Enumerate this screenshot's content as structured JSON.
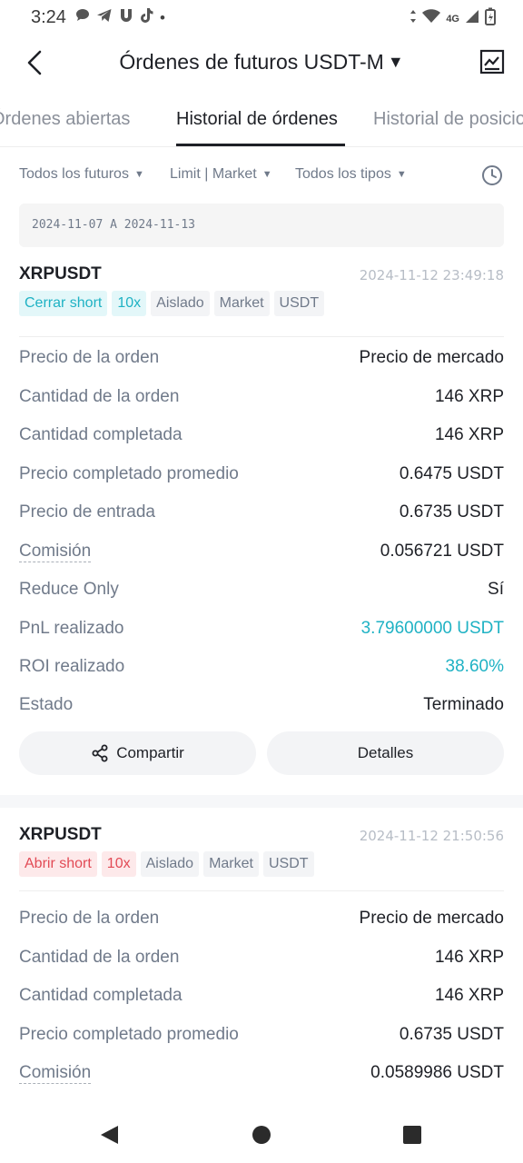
{
  "status_bar": {
    "time": "3:24",
    "notification_icons": [
      "message-icon",
      "telegram-icon",
      "threads-icon",
      "tiktok-icon"
    ],
    "dot": "•",
    "network": "4G",
    "icons": [
      "data-arrows-icon",
      "wifi-icon",
      "signal-icon",
      "battery-icon"
    ]
  },
  "header": {
    "title": "Órdenes de futuros USDT-M",
    "title_caret": "▼"
  },
  "tabs": [
    {
      "label": "Órdenes abiertas",
      "active": false
    },
    {
      "label": "Historial de órdenes",
      "active": true
    },
    {
      "label": "Historial de posiciones",
      "active": false
    }
  ],
  "filters": {
    "futures": "Todos los futuros",
    "order_type": "Limit | Market",
    "all_types": "Todos los tipos",
    "caret": "▼"
  },
  "date_range": "2024-11-07  A  2024-11-13",
  "orders": [
    {
      "symbol": "XRPUSDT",
      "timestamp": "2024-11-12 23:49:18",
      "tags": [
        {
          "label": "Cerrar short",
          "style": "teal"
        },
        {
          "label": "10x",
          "style": "teal"
        },
        {
          "label": "Aislado",
          "style": "gray"
        },
        {
          "label": "Market",
          "style": "gray"
        },
        {
          "label": "USDT",
          "style": "gray"
        }
      ],
      "rows": [
        {
          "label": "Precio de la orden",
          "value": "Precio de mercado"
        },
        {
          "label": "Cantidad de la orden",
          "value": "146 XRP"
        },
        {
          "label": "Cantidad completada",
          "value": "146 XRP"
        },
        {
          "label": "Precio completado promedio",
          "value": "0.6475 USDT"
        },
        {
          "label": "Precio de entrada",
          "value": "0.6735 USDT"
        },
        {
          "label": "Comisión",
          "value": "0.056721 USDT"
        },
        {
          "label": "Reduce Only",
          "value": "Sí"
        },
        {
          "label": "PnL realizado",
          "value": "3.79600000 USDT"
        },
        {
          "label": "ROI realizado",
          "value": "38.60%"
        },
        {
          "label": "Estado",
          "value": "Terminado"
        }
      ],
      "share_label": "Compartir",
      "details_label": "Detalles"
    },
    {
      "symbol": "XRPUSDT",
      "timestamp": "2024-11-12 21:50:56",
      "tags": [
        {
          "label": "Abrir short",
          "style": "red"
        },
        {
          "label": "10x",
          "style": "red"
        },
        {
          "label": "Aislado",
          "style": "gray"
        },
        {
          "label": "Market",
          "style": "gray"
        },
        {
          "label": "USDT",
          "style": "gray"
        }
      ],
      "rows": [
        {
          "label": "Precio de la orden",
          "value": "Precio de mercado"
        },
        {
          "label": "Cantidad de la orden",
          "value": "146 XRP"
        },
        {
          "label": "Cantidad completada",
          "value": "146 XRP"
        },
        {
          "label": "Precio completado promedio",
          "value": "0.6735 USDT"
        },
        {
          "label": "Comisión",
          "value": "0.0589986 USDT"
        }
      ]
    }
  ],
  "colors": {
    "accent_teal": "#1fb2c4",
    "sell_red": "#e24a55",
    "text_primary": "#1e2026",
    "text_secondary": "#707a8a"
  }
}
